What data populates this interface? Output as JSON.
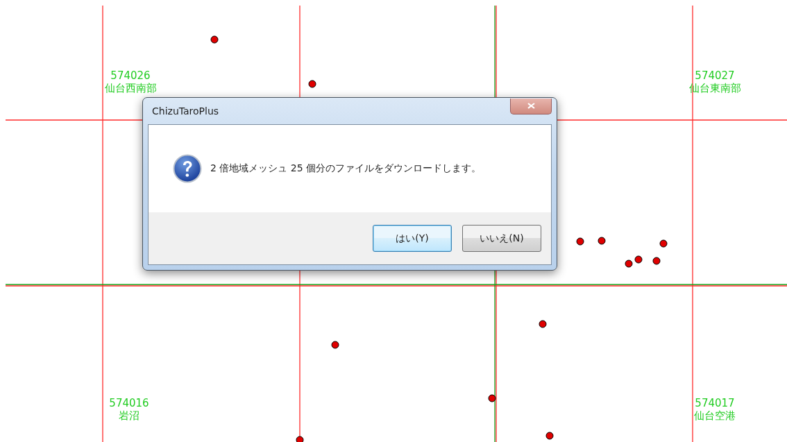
{
  "map": {
    "meshes": [
      {
        "code": "574026",
        "name": "仙台西南部"
      },
      {
        "code": "574027",
        "name": "仙台東南部"
      },
      {
        "code": "574016",
        "name": "岩沼"
      },
      {
        "code": "574017",
        "name": "仙台空港"
      }
    ]
  },
  "dialog": {
    "title": "ChizuTaroPlus",
    "message": "2 倍地域メッシュ 25 個分のファイルをダウンロードします。",
    "buttons": [
      {
        "label": "はい(Y)",
        "selected": true
      },
      {
        "label": "いいえ(N)",
        "selected": false
      }
    ]
  }
}
